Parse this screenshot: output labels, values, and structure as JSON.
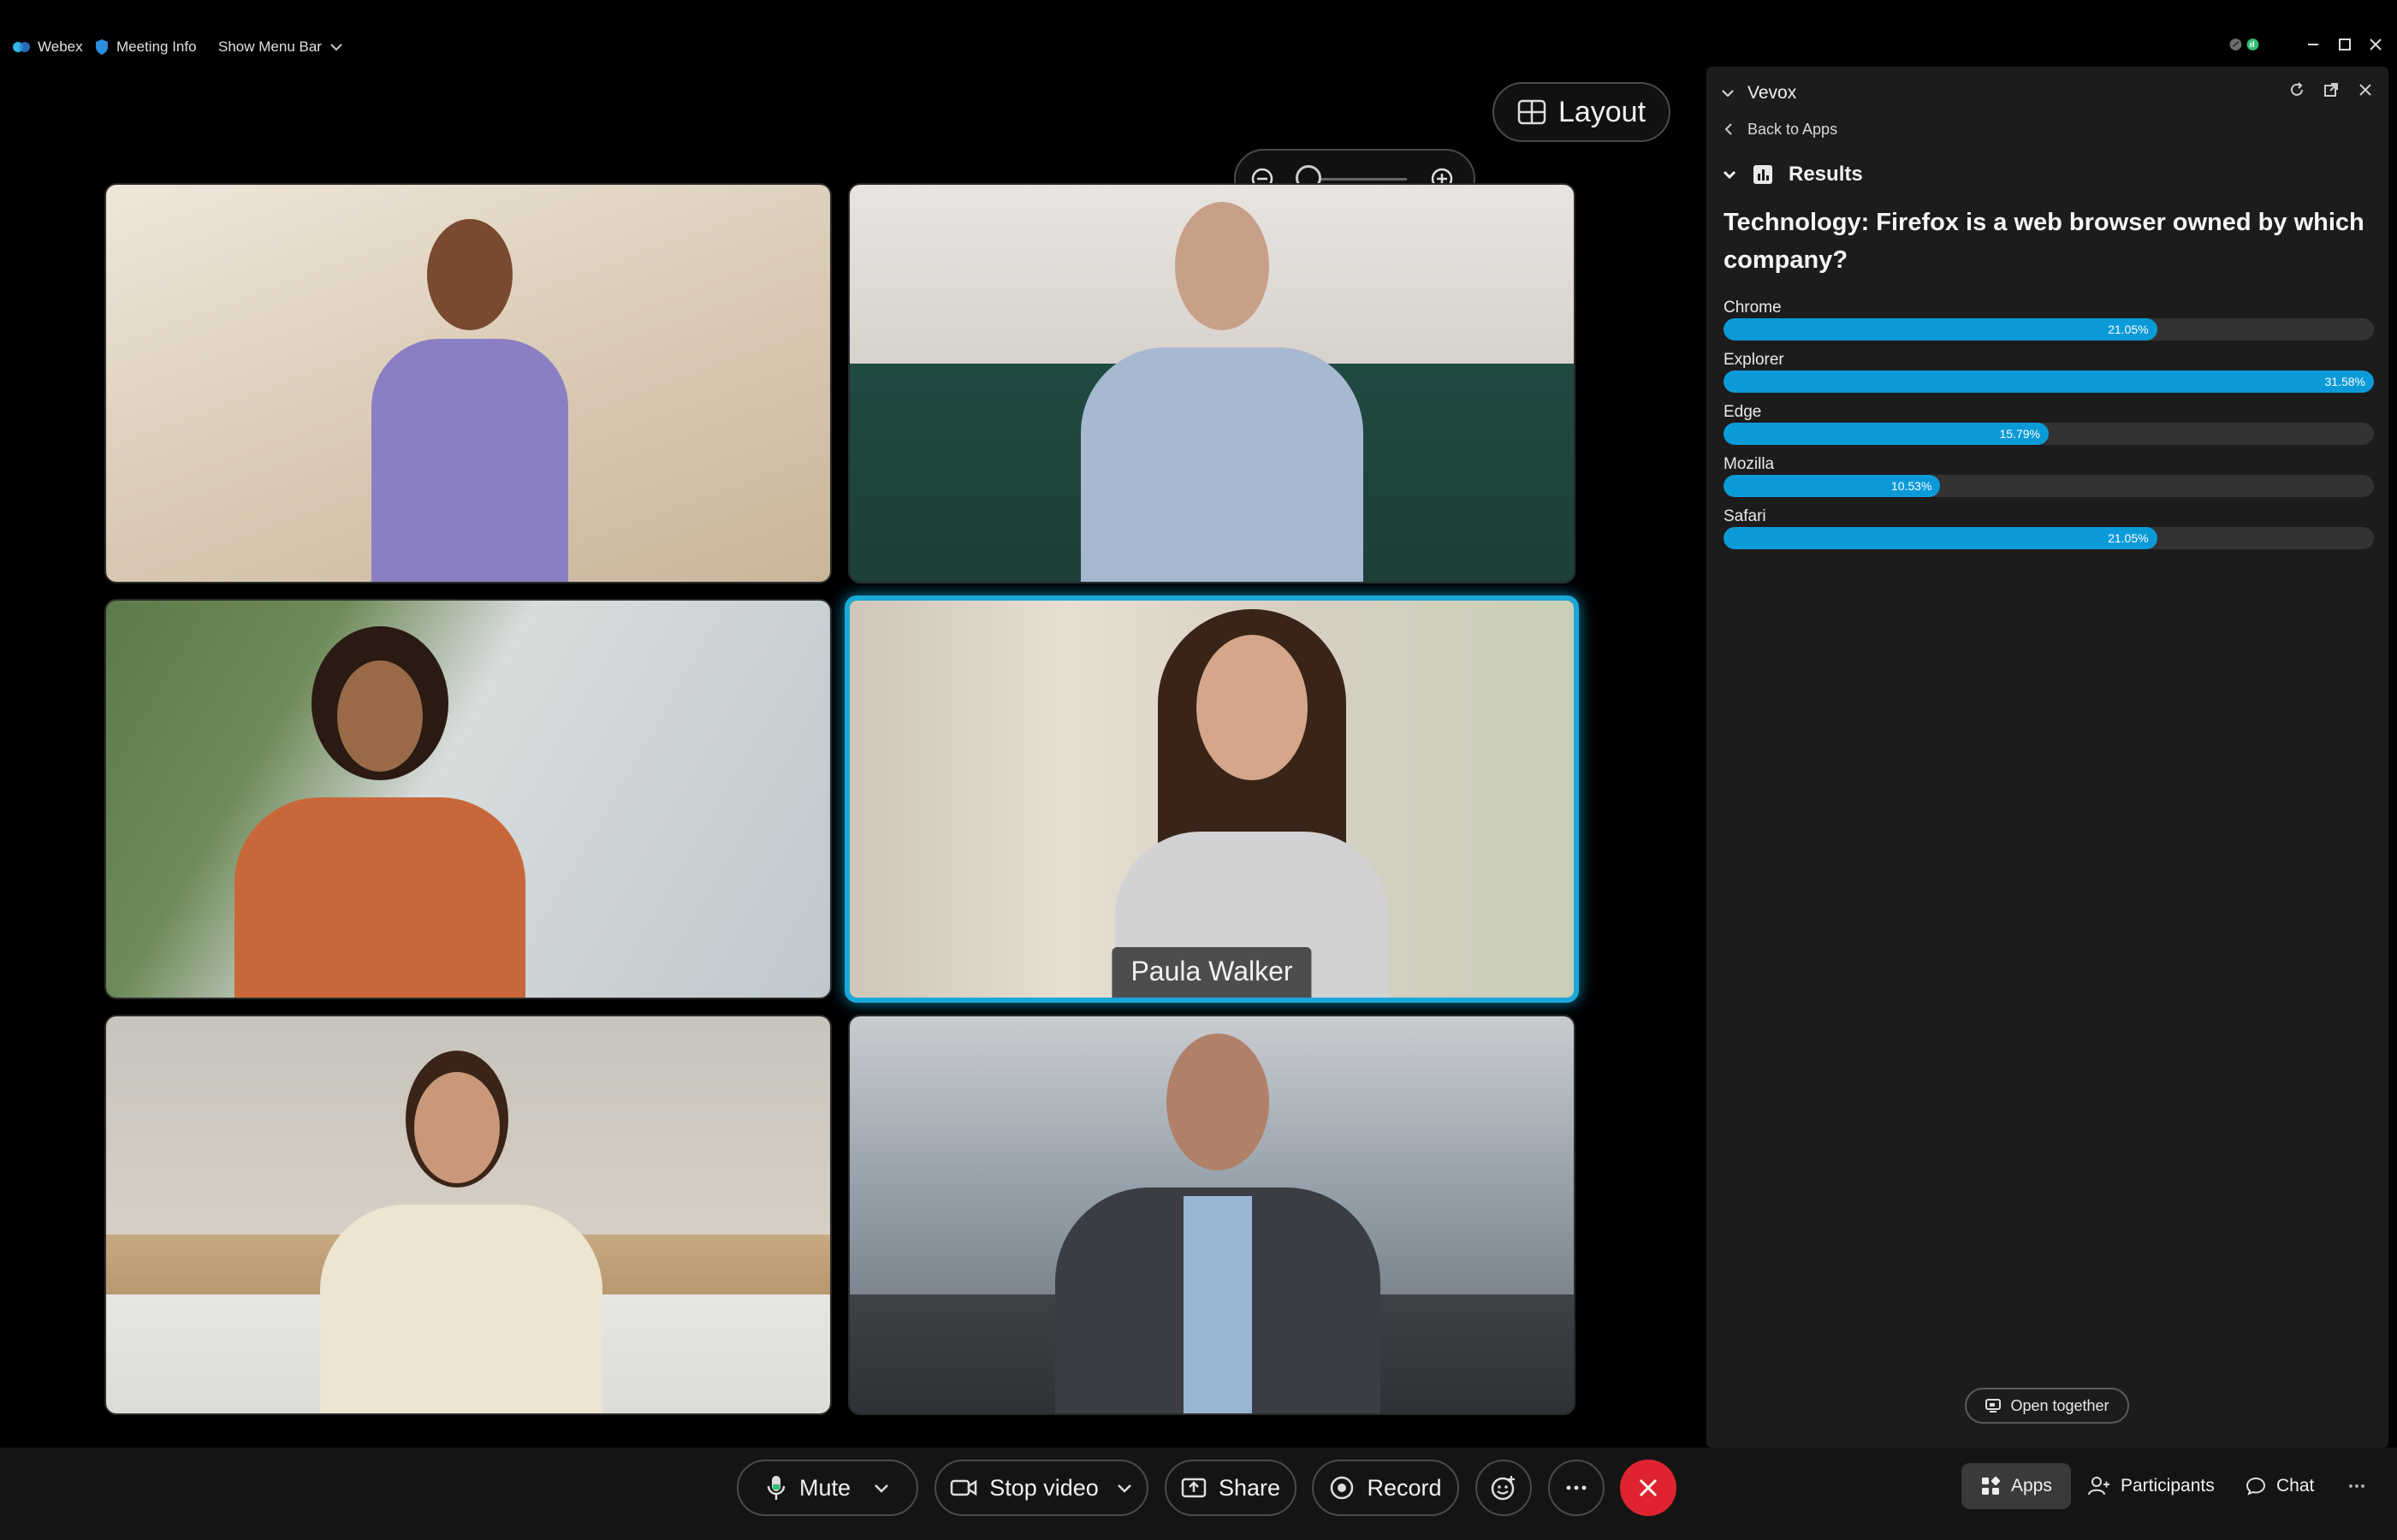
{
  "titlebar": {
    "app_name": "Webex",
    "meeting_info": "Meeting Info",
    "show_menu_bar": "Show Menu Bar"
  },
  "stage": {
    "layout_label": "Layout",
    "participants": [
      {
        "name": ""
      },
      {
        "name": ""
      },
      {
        "name": ""
      },
      {
        "name": "Paula Walker"
      },
      {
        "name": ""
      },
      {
        "name": ""
      }
    ]
  },
  "panel": {
    "title": "Vevox",
    "back_label": "Back to Apps",
    "results_label": "Results",
    "question": "Technology: Firefox is a web browser owned by which company?",
    "open_together": "Open together",
    "options": [
      {
        "label": "Chrome",
        "percent_text": "21.05%",
        "percent": 21.05
      },
      {
        "label": "Explorer",
        "percent_text": "31.58%",
        "percent": 31.58
      },
      {
        "label": "Edge",
        "percent_text": "15.79%",
        "percent": 15.79
      },
      {
        "label": "Mozilla",
        "percent_text": "10.53%",
        "percent": 10.53
      },
      {
        "label": "Safari",
        "percent_text": "21.05%",
        "percent": 21.05
      }
    ],
    "max_percent": 31.58
  },
  "controls": {
    "mute": "Mute",
    "stop_video": "Stop video",
    "share": "Share",
    "record": "Record",
    "apps": "Apps",
    "participants": "Participants",
    "chat": "Chat"
  },
  "colors": {
    "accent": "#0b9ad8",
    "active_border": "#19a8d8",
    "end_call": "#e0242f"
  }
}
